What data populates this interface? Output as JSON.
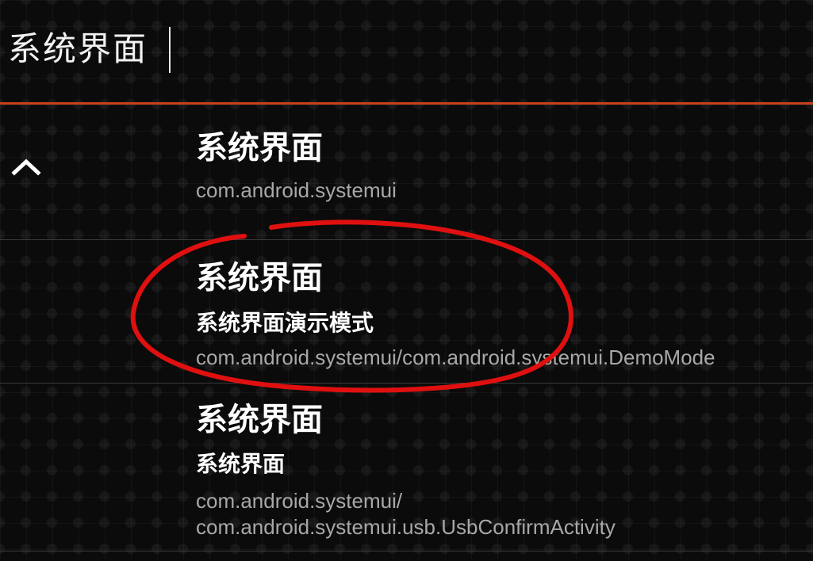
{
  "search": {
    "query": "系统界面"
  },
  "colors": {
    "accent_underline": "#c8401c",
    "annotation_red": "#e01010",
    "package_text": "#a8a8a8"
  },
  "icons": {
    "collapse": "chevron-up-icon"
  },
  "results": [
    {
      "title": "系统界面",
      "package": "com.android.systemui"
    },
    {
      "title": "系统界面",
      "activity_label": "系统界面演示模式",
      "component": "com.android.systemui/com.android.systemui.DemoMode"
    },
    {
      "title": "系统界面",
      "activity_label": "系统界面",
      "component_line1": "com.android.systemui/",
      "component_line2": "com.android.systemui.usb.UsbConfirmActivity"
    }
  ]
}
